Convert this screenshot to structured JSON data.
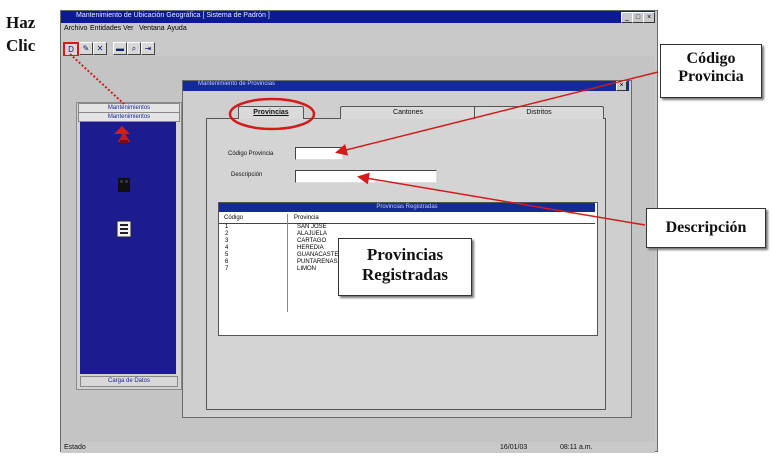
{
  "annotations": {
    "haz": "Haz",
    "clic": "Clic",
    "codigo_provincia_line1": "Código",
    "codigo_provincia_line2": "Provincia",
    "descripcion": "Descripción",
    "provincias_line1": "Provincias",
    "provincias_line2": "Registradas"
  },
  "window": {
    "title": "Mantenimiento de Ubicación Geográfica [ Sistema de Padrón ]",
    "controls": [
      "_",
      "□",
      "×"
    ]
  },
  "menu": {
    "items": [
      "Archivo",
      "Entidades",
      "Ver",
      "Ventana",
      "Ayuda"
    ]
  },
  "toolbar": {
    "buttons": [
      {
        "icon": "new-icon",
        "glyph": "D"
      },
      {
        "icon": "edit-icon",
        "glyph": "✎"
      },
      {
        "icon": "delete-icon",
        "glyph": "✕"
      },
      {
        "icon": "save-icon",
        "glyph": "▬"
      },
      {
        "icon": "search-icon",
        "glyph": "⌕"
      },
      {
        "icon": "exit-icon",
        "glyph": "⇥"
      }
    ]
  },
  "nav": {
    "tab1": "Mantenimientos",
    "tab2": "Mantenimientos",
    "footer": "Carga de Datos"
  },
  "child": {
    "title": "Mantenimiento de Provincias",
    "close": "×"
  },
  "tabs": [
    "Provincias",
    "Cantones",
    "Distritos"
  ],
  "form": {
    "codigo_label": "Código Provincia",
    "codigo_value": "",
    "descripcion_label": "Descripción",
    "descripcion_value": ""
  },
  "grid": {
    "title": "Provincias Registradas",
    "columns": [
      "Código",
      "Provincia"
    ],
    "rows": [
      [
        "1",
        "SAN JOSE"
      ],
      [
        "2",
        "ALAJUELA"
      ],
      [
        "3",
        "CARTAGO"
      ],
      [
        "4",
        "HEREDIA"
      ],
      [
        "5",
        "GUANACASTE"
      ],
      [
        "6",
        "PUNTARENAS"
      ],
      [
        "7",
        "LIMON"
      ]
    ]
  },
  "status": {
    "left": "Estado",
    "date": "16/01/03",
    "time": "08:11 a.m."
  },
  "colors": {
    "titlebar": "#0c1a96",
    "highlight": "#d41a1a",
    "nav_panel": "#1c1c90"
  }
}
